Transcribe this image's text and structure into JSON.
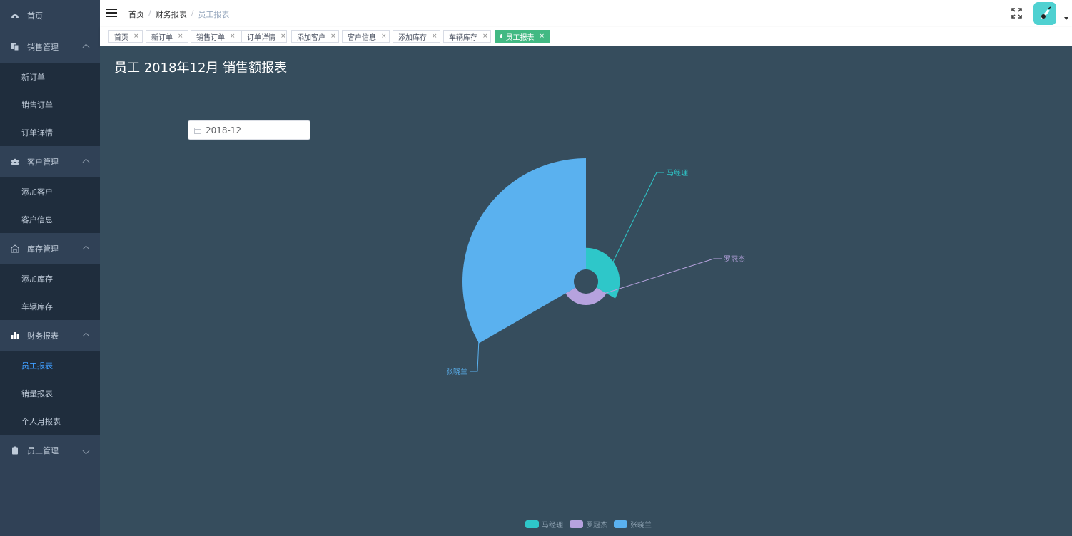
{
  "sidebar": {
    "home": "首页",
    "groups": [
      {
        "label": "销售管理",
        "items": [
          "新订单",
          "销售订单",
          "订单详情"
        ]
      },
      {
        "label": "客户管理",
        "items": [
          "添加客户",
          "客户信息"
        ]
      },
      {
        "label": "库存管理",
        "items": [
          "添加库存",
          "车辆库存"
        ]
      },
      {
        "label": "财务报表",
        "items": [
          "员工报表",
          "销量报表",
          "个人月报表"
        ]
      },
      {
        "label": "员工管理",
        "items": []
      }
    ],
    "active_item": "员工报表"
  },
  "header": {
    "breadcrumb": [
      "首页",
      "财务报表",
      "员工报表"
    ]
  },
  "tags": [
    {
      "label": "首页"
    },
    {
      "label": "新订单"
    },
    {
      "label": "销售订单"
    },
    {
      "label": "订单详情"
    },
    {
      "label": "添加客户"
    },
    {
      "label": "客户信息"
    },
    {
      "label": "添加库存"
    },
    {
      "label": "车辆库存"
    },
    {
      "label": "员工报表",
      "active": true
    }
  ],
  "tag_close": "×",
  "page": {
    "title": "员工 2018年12月 销售额报表",
    "month_value": "2018-12"
  },
  "chart_data": {
    "type": "pie",
    "rose": true,
    "series": [
      {
        "name": "马经理",
        "value": 12,
        "color": "#2ec7c9"
      },
      {
        "name": "罗冠杰",
        "value": 2,
        "color": "#b6a2de"
      },
      {
        "name": "张晓兰",
        "value": 100,
        "color": "#5ab1ef"
      }
    ],
    "legend_position": "bottom"
  },
  "colors": {
    "sidebar": "#304156",
    "submenu": "#1f2d3d",
    "active": "#409eff",
    "tag_active": "#42b983",
    "main_bg": "#364d5d"
  }
}
